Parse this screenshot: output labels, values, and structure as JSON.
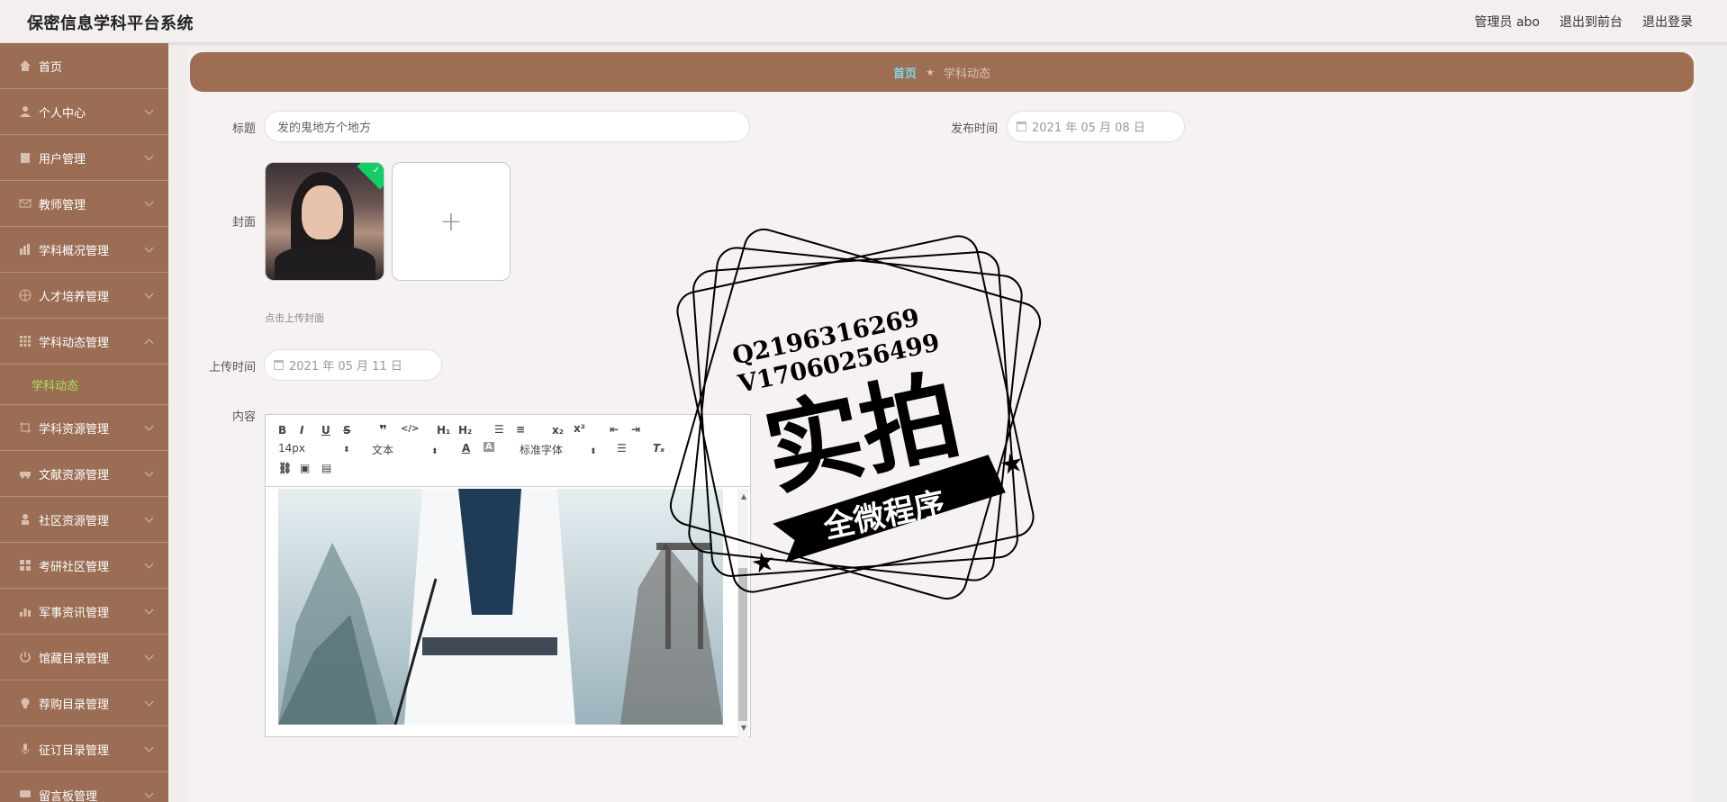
{
  "header": {
    "app_title": "保密信息学科平台系统",
    "admin_label": "管理员 abo",
    "exit_front": "退出到前台",
    "logout": "退出登录"
  },
  "sidebar": {
    "items": [
      {
        "label": "首页",
        "icon": "home-icon"
      },
      {
        "label": "个人中心",
        "icon": "user-icon"
      },
      {
        "label": "用户管理",
        "icon": "clipboard-icon"
      },
      {
        "label": "教师管理",
        "icon": "mail-icon"
      },
      {
        "label": "学科概况管理",
        "icon": "chart-icon"
      },
      {
        "label": "人才培养管理",
        "icon": "globe-icon"
      },
      {
        "label": "学科动态管理",
        "icon": "grid-icon"
      },
      {
        "label": "学科资源管理",
        "icon": "crop-icon"
      },
      {
        "label": "文献资源管理",
        "icon": "car-icon"
      },
      {
        "label": "社区资源管理",
        "icon": "person-icon"
      },
      {
        "label": "考研社区管理",
        "icon": "apps-icon"
      },
      {
        "label": "军事资讯管理",
        "icon": "bar-icon"
      },
      {
        "label": "馆藏目录管理",
        "icon": "power-icon"
      },
      {
        "label": "荐购目录管理",
        "icon": "bulb-icon"
      },
      {
        "label": "征订目录管理",
        "icon": "mic-icon"
      },
      {
        "label": "留言板管理",
        "icon": "chat-icon"
      }
    ],
    "active_sub": "学科动态"
  },
  "breadcrumb": {
    "home": "首页",
    "current": "学科动态"
  },
  "form": {
    "title_label": "标题",
    "title_value": "发的鬼地方个地方",
    "publish_label": "发布时间",
    "publish_value": "2021 年 05 月 08 日",
    "cover_label": "封面",
    "upload_hint": "点击上传封面",
    "upload_label": "上传时间",
    "upload_value": "2021 年 05 月 11 日",
    "content_label": "内容"
  },
  "editor": {
    "font_size": "14px",
    "block_type": "文本",
    "font_family": "标准字体"
  },
  "watermark": {
    "line1": "Q2196316269",
    "line2": "V17060256499",
    "big": "实拍",
    "banner": "全微程序"
  }
}
